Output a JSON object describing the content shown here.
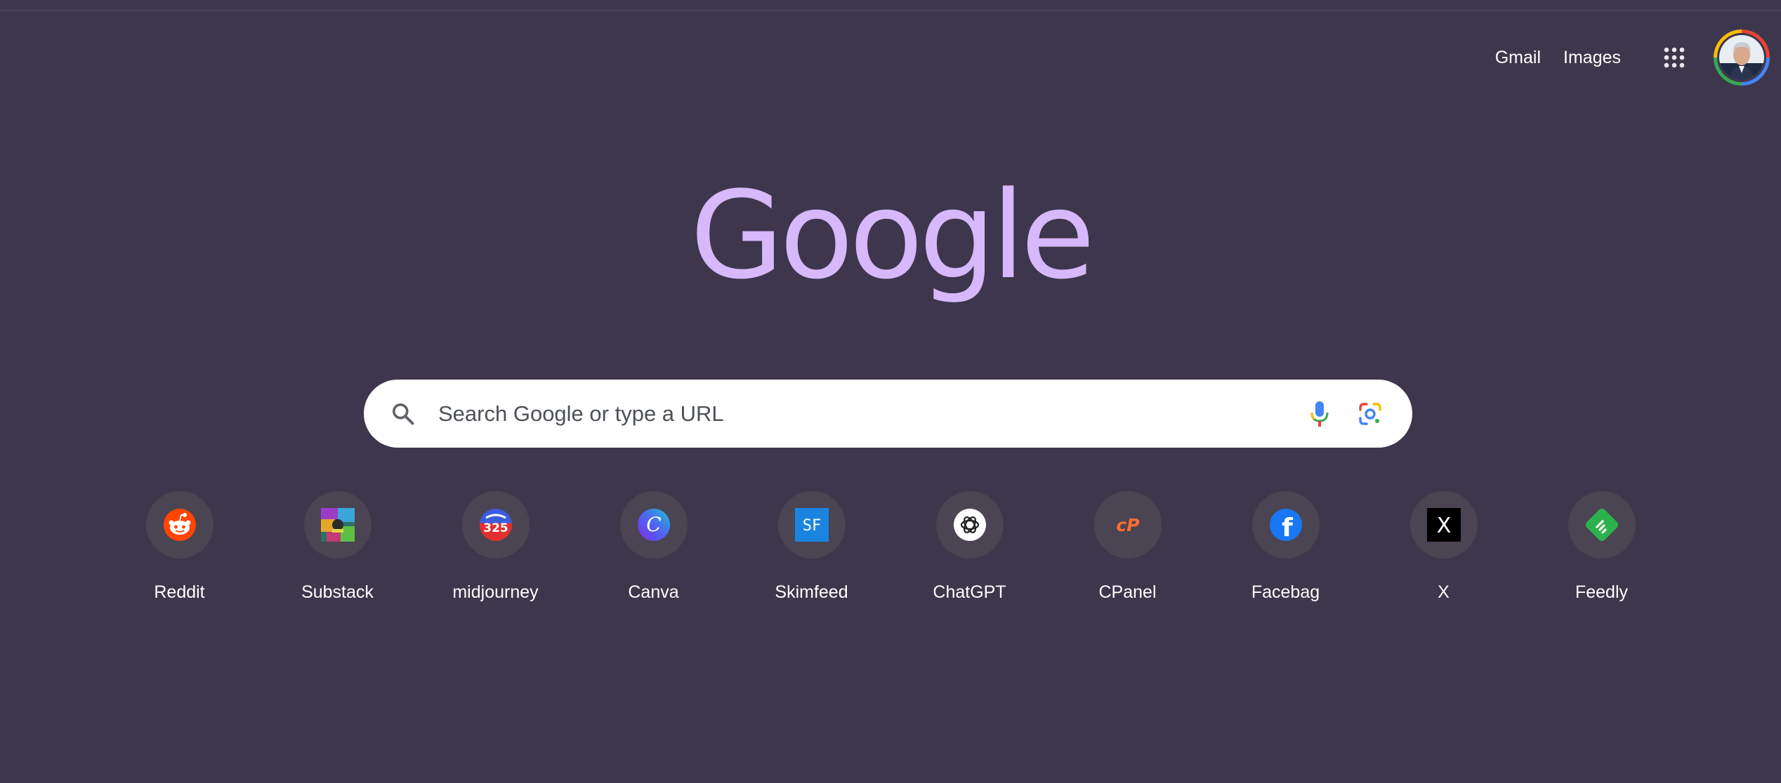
{
  "header": {
    "gmail_label": "Gmail",
    "images_label": "Images",
    "apps_icon": "apps-grid-icon",
    "avatar_icon": "account-avatar"
  },
  "logo": {
    "text": "Google",
    "color": "#d7b8fb"
  },
  "search": {
    "placeholder": "Search Google or type a URL",
    "value": "",
    "left_icon": "search-icon",
    "right_icons": [
      "microphone-icon",
      "google-lens-icon"
    ]
  },
  "shortcuts": [
    {
      "label": "Reddit",
      "icon": "reddit-icon"
    },
    {
      "label": "Substack",
      "icon": "substack-icon"
    },
    {
      "label": "midjourney",
      "icon": "midjourney-icon",
      "badge": "325"
    },
    {
      "label": "Canva",
      "icon": "canva-icon",
      "glyph": "C"
    },
    {
      "label": "Skimfeed",
      "icon": "skimfeed-icon",
      "glyph": "SF"
    },
    {
      "label": "ChatGPT",
      "icon": "chatgpt-icon"
    },
    {
      "label": "CPanel",
      "icon": "cpanel-icon",
      "glyph": "cP"
    },
    {
      "label": "Facebag",
      "icon": "facebook-icon",
      "glyph": "f"
    },
    {
      "label": "X",
      "icon": "x-icon",
      "glyph": "X"
    },
    {
      "label": "Feedly",
      "icon": "feedly-icon"
    }
  ],
  "colors": {
    "background": "#3e364c",
    "tile_background": "#4b4452",
    "search_background": "#ffffff"
  }
}
